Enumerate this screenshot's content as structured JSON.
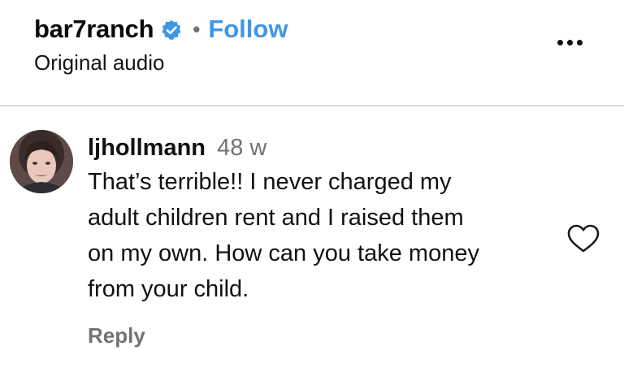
{
  "post": {
    "username": "bar7ranch",
    "separator": "•",
    "follow_label": "Follow",
    "audio_label": "Original audio",
    "icons": {
      "verified": "verified-badge-icon",
      "more": "more-options-icon"
    },
    "colors": {
      "follow": "#3f96e9",
      "verified": "#3f96e9",
      "muted": "#737373",
      "divider": "#dbdbdb"
    }
  },
  "comment": {
    "username": "ljhollmann",
    "time": "48 w",
    "text_lines": [
      "That’s terrible!! I never charged my",
      "adult children rent and I raised them",
      "on my own. How can you take money",
      "from your child."
    ],
    "reply_label": "Reply",
    "icons": {
      "avatar": "avatar",
      "like": "heart-icon"
    }
  }
}
